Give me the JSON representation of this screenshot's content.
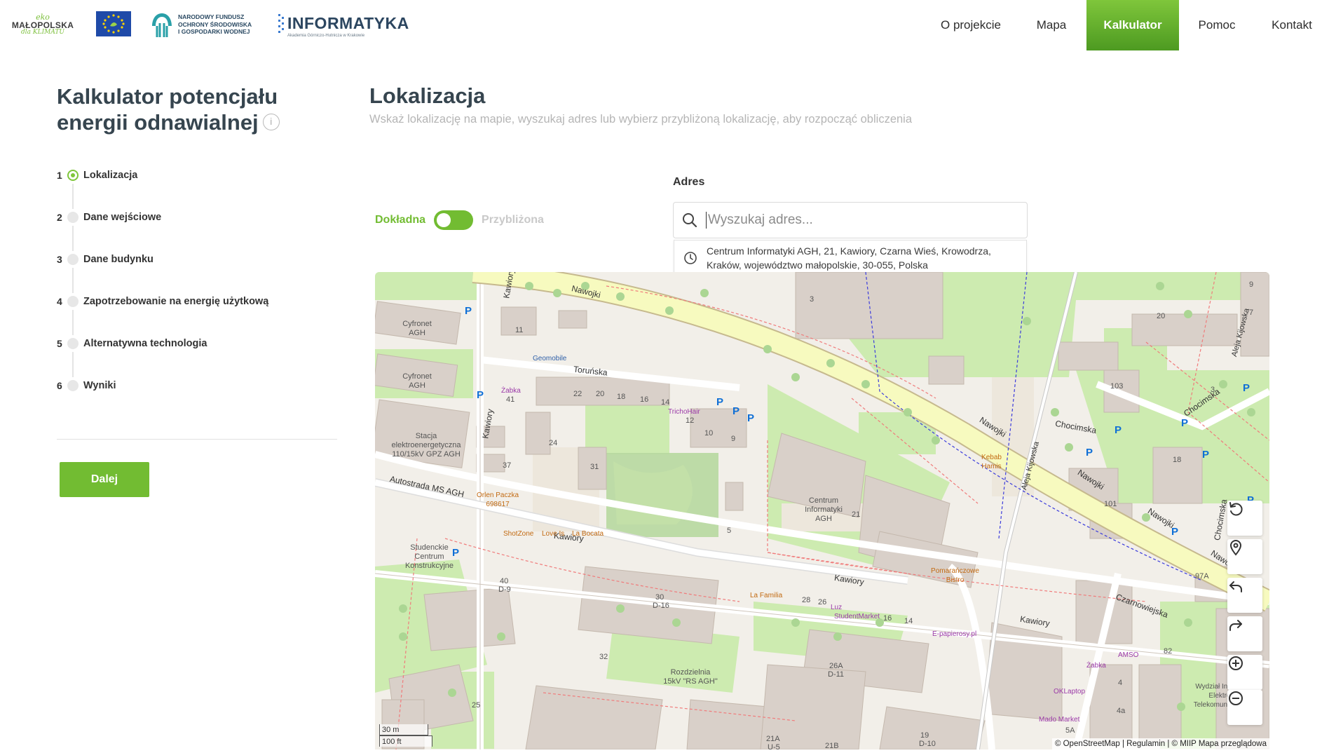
{
  "header": {
    "logos": {
      "eko_top": "eko",
      "malopolska": "MAŁOPOLSKA",
      "dla_klimatu": "dla KLIMATU",
      "nfos_lines": [
        "NARODOWY FUNDUSZ",
        "OCHRONY ŚRODOWISKA",
        "I GOSPODARKI WODNEJ"
      ],
      "informatyka": "INFORMATYKA",
      "informatyka_sub": "Akademia Górniczo-Hutnicza w Krakowie"
    },
    "nav": [
      {
        "label": "O projekcie"
      },
      {
        "label": "Mapa"
      },
      {
        "label": "Kalkulator",
        "active": true
      },
      {
        "label": "Pomoc"
      },
      {
        "label": "Kontakt"
      }
    ]
  },
  "sidebar": {
    "title": "Kalkulator potencjału energii odnawialnej",
    "info_icon": "info-icon",
    "steps": [
      {
        "num": "1",
        "label": "Lokalizacja",
        "active": true
      },
      {
        "num": "2",
        "label": "Dane wejściowe"
      },
      {
        "num": "3",
        "label": "Dane budynku"
      },
      {
        "num": "4",
        "label": "Zapotrzebowanie na energię użytkową"
      },
      {
        "num": "5",
        "label": "Alternatywna technologia"
      },
      {
        "num": "6",
        "label": "Wyniki"
      }
    ],
    "next_button": "Dalej"
  },
  "main": {
    "title": "Lokalizacja",
    "subtitle": "Wskaż lokalizację na mapie, wyszukaj adres lub wybierz przybliżoną lokalizację, aby rozpocząć obliczenia",
    "toggle": {
      "left": "Dokładna",
      "right": "Przybliżona",
      "state": "Dokładna"
    },
    "address_label": "Adres",
    "search": {
      "placeholder": "Wyszukaj adres...",
      "value": ""
    },
    "suggestion": "Centrum Informatyki AGH, 21, Kawiory, Czarna Wieś, Krowodrza, Kraków, województwo małopolskie, 30-055, Polska"
  },
  "map": {
    "labels": {
      "nawojki": "Nawojki",
      "torunska": "Toruńska",
      "kawiory": "Kawiory",
      "autostrada": "Autostrada MS AGH",
      "aleja_kijowska": "Aleja Kijowska",
      "chocimska": "Chocimska",
      "czarnowiejska": "Czarnowiejska",
      "cyfronet": "Cyfronet AGH",
      "centrum": "Centrum Informatyki AGH",
      "centrum_num": "21",
      "stacja": "Stacja elektroenergetyczna 110/15kV GPZ AGH",
      "studenckie": "Studenckie Centrum Konstrukcyjne",
      "rozdzielnia": "Rozdzielnia 15kV \"RS AGH\"",
      "zabka": "Żabka",
      "trichohair": "TrichoHair",
      "geomobile": "Geomobile",
      "orlen": "Orlen Paczka 698617",
      "shotzone": "ShotZone",
      "love_is": "Love Is",
      "la_bocata": "La Bocata",
      "la_familia": "La Familia",
      "luz": "Luz",
      "studentmarket": "StudentMarket",
      "epapierosy": "E-papierosy.pl",
      "pomaranczowe": "Pomarańczowe Bistro",
      "kebab": "Kebab Hamis",
      "amso": "AMSO",
      "oklaptop": "OKLaptop",
      "mado": "Mado Market",
      "wydzial": "Wydział Informatyki, Elektroniki i Telekomunikacji AGH",
      "n_11": "11",
      "n_41": "41",
      "n_22": "22",
      "n_20": "20",
      "n_18": "18",
      "n_16": "16",
      "n_14": "14",
      "n_12": "12",
      "n_10": "10",
      "n_9": "9",
      "n_24": "24",
      "n_37": "37",
      "n_31": "31",
      "n_5": "5",
      "n_40": "40",
      "n_d9": "D-9",
      "n_30": "30",
      "n_d16": "D-16",
      "n_32": "32",
      "n_28": "28",
      "n_26": "26",
      "n_26a": "26A",
      "n_d11": "D-11",
      "n_25": "25",
      "n_19": "19",
      "n_d10": "D-10",
      "n_21a": "21A",
      "n_u5": "U-5",
      "n_21b": "21B",
      "n_3": "3",
      "n_103": "103",
      "n_101": "101",
      "n_18r": "18",
      "n_20r": "20",
      "n_97a": "97A",
      "n_82": "82",
      "n_4": "4",
      "n_4a": "4a",
      "n_5a": "5A",
      "n_7": "7",
      "n_9r": "9"
    },
    "scale_m": "30 m",
    "scale_ft": "100 ft",
    "attribution": "© OpenStreetMap | Regulamin | © MIIP Mapa przeglądowa",
    "controls": [
      "reset-icon",
      "location-pin-icon",
      "undo-icon",
      "redo-icon",
      "zoom-in-icon",
      "zoom-out-icon"
    ]
  },
  "colors": {
    "accent_green": "#72bc32",
    "nav_active_top": "#7fc63b",
    "nav_active_bottom": "#4d9a21",
    "map_land": "#f2efe9",
    "map_grass": "#cdebb0",
    "map_building": "#d9d0c9",
    "map_road_major": "#f7fabf"
  }
}
